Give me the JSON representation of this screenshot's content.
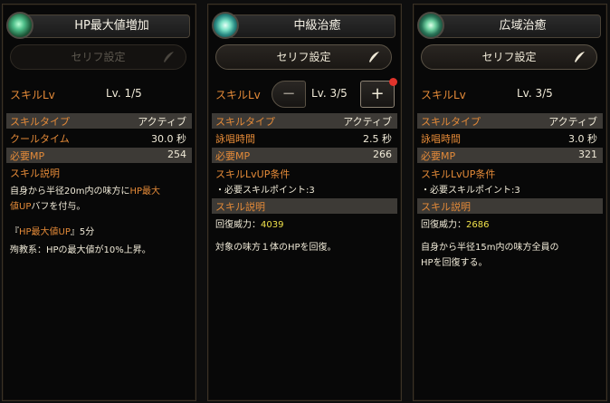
{
  "panels": [
    {
      "title": "HP最大値増加",
      "serif_label": "セリフ設定",
      "lv_label": "スキルLv",
      "lv_value": "Lv. 1/5",
      "skill_type_label": "スキルタイプ",
      "skill_type_value": "アクティブ",
      "row2_label": "クールタイム",
      "row2_value": "30.0 秒",
      "mp_label": "必要MP",
      "mp_value": "254",
      "desc_head": "スキル説明",
      "desc_line1_a": "自身から半径20m内の味方に",
      "desc_line1_hl": "HP最大",
      "desc_line2_hl": "値UP",
      "desc_line2_b": "バフを付与。",
      "buff_open": "『",
      "buff_name": "HP最大値UP",
      "buff_close": "』5分",
      "buff_effect": "殉教系：HPの最大値が10%上昇。"
    },
    {
      "title": "中級治癒",
      "serif_label": "セリフ設定",
      "lv_label": "スキルLv",
      "lv_value": "Lv. 3/5",
      "minus": "−",
      "plus": "+",
      "skill_type_label": "スキルタイプ",
      "skill_type_value": "アクティブ",
      "row2_label": "詠唱時間",
      "row2_value": "2.5 秒",
      "mp_label": "必要MP",
      "mp_value": "266",
      "cond_head": "スキルLvUP条件",
      "cond_text": "・必要スキルポイント:3",
      "desc_head": "スキル説明",
      "power_label": "回復威力：",
      "power_value": "4039",
      "desc_text": "対象の味方１体のHPを回復。"
    },
    {
      "title": "広域治癒",
      "serif_label": "セリフ設定",
      "lv_label": "スキルLv",
      "lv_value": "Lv. 3/5",
      "skill_type_label": "スキルタイプ",
      "skill_type_value": "アクティブ",
      "row2_label": "詠唱時間",
      "row2_value": "3.0 秒",
      "mp_label": "必要MP",
      "mp_value": "321",
      "cond_head": "スキルLvUP条件",
      "cond_text": "・必要スキルポイント:3",
      "desc_head": "スキル説明",
      "power_label": "回復威力：",
      "power_value": "2686",
      "desc_line1": "自身から半径15m内の味方全員の",
      "desc_line2": "HPを回復する。"
    }
  ],
  "colors": {
    "accent_orange": "#e48a38",
    "value_yellow": "#efe04a",
    "notification_red": "#e0332b"
  },
  "icons": [
    "heal-buff-icon",
    "heal-orb-icon",
    "area-heal-icon",
    "quill-pen-icon"
  ]
}
